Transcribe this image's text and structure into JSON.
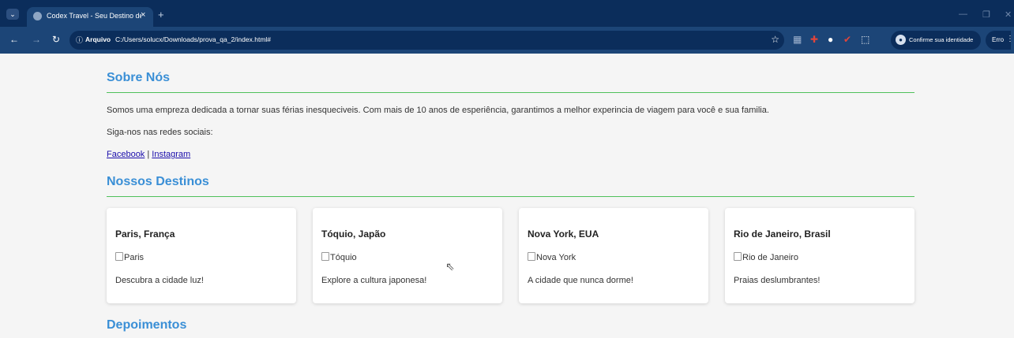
{
  "browser": {
    "tab_title": "Codex Travel - Seu Destino de I",
    "tab_close": "×",
    "new_tab": "+",
    "address_label": "Arquivo",
    "url": "C:/Users/solucx/Downloads/prova_qa_2/index.html#",
    "identity_text": "Confirme sua identidade",
    "error_label": "Erro"
  },
  "about": {
    "heading": "Sobre Nós",
    "text": "Somos uma empreza dedicada a tornar suas férias inesqueciveis. Com mais de 10 anos de esperiência, garantimos a melhor experincia de viagem para você e sua familia.",
    "social_prompt": "Siga-nos nas redes sociais:",
    "facebook": "Facebook",
    "separator": " | ",
    "instagram": "Instagram"
  },
  "destinations": {
    "heading": "Nossos Destinos",
    "cards": [
      {
        "title": "Paris, França",
        "img_alt": "Paris",
        "desc": "Descubra a cidade luz!"
      },
      {
        "title": "Tóquio, Japão",
        "img_alt": "Tóquio",
        "desc": "Explore a cultura japonesa!"
      },
      {
        "title": "Nova York, EUA",
        "img_alt": "Nova York",
        "desc": "A cidade que nunca dorme!"
      },
      {
        "title": "Rio de Janeiro, Brasil",
        "img_alt": "Rio de Janeiro",
        "desc": "Praias deslumbrantes!"
      }
    ]
  },
  "testimonials": {
    "heading": "Depoimentos"
  },
  "colors": {
    "chrome_dark": "#0b2d5b",
    "chrome_mid": "#1c4577",
    "heading_blue": "#3a8fd6",
    "rule_green": "#4fc15a"
  }
}
